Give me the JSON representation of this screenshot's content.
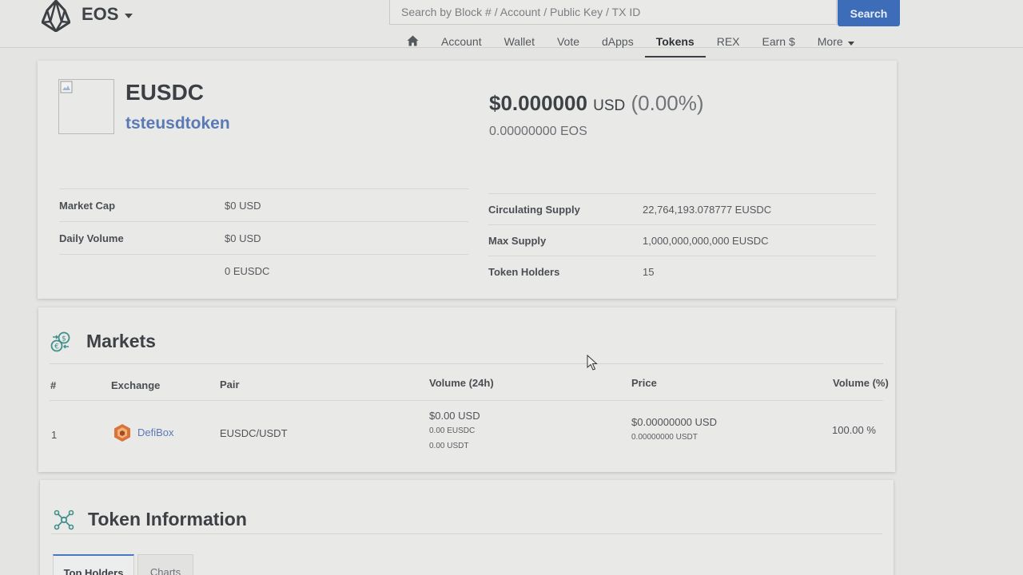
{
  "header": {
    "chain": "EOS",
    "search_placeholder": "Search by Block # / Account / Public Key / TX ID",
    "search_button": "Search",
    "nav": [
      "Account",
      "Wallet",
      "Vote",
      "dApps",
      "Tokens",
      "REX",
      "Earn $",
      "More"
    ],
    "active_nav": "Tokens"
  },
  "token": {
    "symbol": "EUSDC",
    "contract": "tsteusdtoken",
    "price_usd": "$0.000000",
    "price_currency": "USD",
    "change": "(0.00%)",
    "price_eos": "0.00000000 EOS",
    "left_stats": [
      {
        "label": "Market Cap",
        "value": "$0 USD"
      },
      {
        "label": "Daily Volume",
        "value": "$0 USD"
      },
      {
        "label": "",
        "value": "0 EUSDC"
      }
    ],
    "right_stats": [
      {
        "label": "Circulating Supply",
        "value": "22,764,193.078777 EUSDC"
      },
      {
        "label": "Max Supply",
        "value": "1,000,000,000,000 EUSDC"
      },
      {
        "label": "Token Holders",
        "value": "15"
      }
    ]
  },
  "markets": {
    "title": "Markets",
    "columns": [
      "#",
      "Exchange",
      "Pair",
      "Volume (24h)",
      "Price",
      "Volume (%)"
    ],
    "rows": [
      {
        "index": "1",
        "exchange": "DefiBox",
        "pair": "EUSDC/USDT",
        "volume_usd": "$0.00 USD",
        "volume_token": "0.00 EUSDC",
        "volume_quote": "0.00 USDT",
        "price_usd": "$0.00000000 USD",
        "price_quote": "0.00000000 USDT",
        "volume_pct": "100.00 %"
      }
    ]
  },
  "token_info": {
    "title": "Token Information",
    "tabs": [
      "Top Holders",
      "Charts"
    ],
    "active_tab": "Top Holders"
  },
  "colors": {
    "background": "#e4e5e3",
    "card": "#e9eae8",
    "accent_blue": "#3d6db8",
    "link_blue": "#5b79b5",
    "defibox_orange": "#d9733a"
  }
}
